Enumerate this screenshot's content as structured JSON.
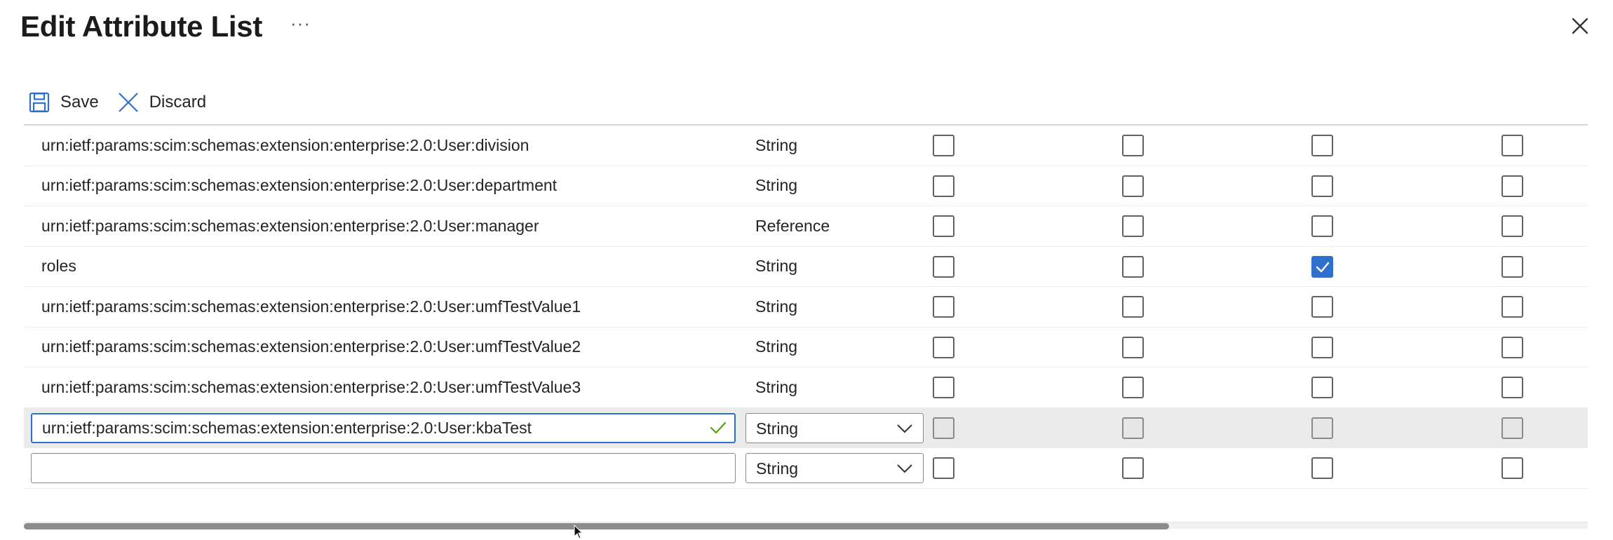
{
  "header": {
    "title": "Edit Attribute List",
    "more_label": "···"
  },
  "toolbar": {
    "save_label": "Save",
    "discard_label": "Discard"
  },
  "table": {
    "rows": [
      {
        "name": "urn:ietf:params:scim:schemas:extension:enterprise:2.0:User:division",
        "type": "String",
        "checks": [
          false,
          false,
          false,
          false
        ]
      },
      {
        "name": "urn:ietf:params:scim:schemas:extension:enterprise:2.0:User:department",
        "type": "String",
        "checks": [
          false,
          false,
          false,
          false
        ]
      },
      {
        "name": "urn:ietf:params:scim:schemas:extension:enterprise:2.0:User:manager",
        "type": "Reference",
        "checks": [
          false,
          false,
          false,
          false
        ]
      },
      {
        "name": "roles",
        "type": "String",
        "checks": [
          false,
          false,
          true,
          false
        ]
      },
      {
        "name": "urn:ietf:params:scim:schemas:extension:enterprise:2.0:User:umfTestValue1",
        "type": "String",
        "checks": [
          false,
          false,
          false,
          false
        ]
      },
      {
        "name": "urn:ietf:params:scim:schemas:extension:enterprise:2.0:User:umfTestValue2",
        "type": "String",
        "checks": [
          false,
          false,
          false,
          false
        ]
      },
      {
        "name": "urn:ietf:params:scim:schemas:extension:enterprise:2.0:User:umfTestValue3",
        "type": "String",
        "checks": [
          false,
          false,
          false,
          false
        ]
      }
    ],
    "edit_row": {
      "name_value": "urn:ietf:params:scim:schemas:extension:enterprise:2.0:User:kbaTest",
      "type_value": "String",
      "checks": [
        false,
        false,
        false,
        false
      ]
    },
    "new_row": {
      "name_value": "",
      "type_value": "String",
      "checks": [
        false,
        false,
        false,
        false
      ]
    }
  },
  "colors": {
    "accent": "#2f6fce",
    "selected_row": "#ebebeb",
    "valid_check": "#57a300"
  }
}
